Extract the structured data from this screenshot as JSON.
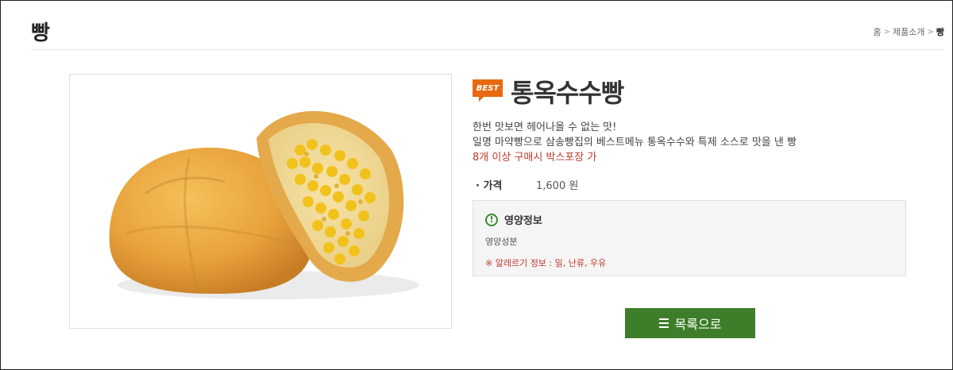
{
  "page": {
    "title": "빵"
  },
  "breadcrumb": {
    "home": "홈",
    "category": "제품소개",
    "current": "빵",
    "separator": ">"
  },
  "product": {
    "badge": "BEST",
    "name": "통옥수수빵",
    "desc_line1": "한번 맛보면 헤어나올 수 없는 맛!",
    "desc_line2": "일명 마약빵으로 삼송빵집의 베스트메뉴 통옥수수와 특제 소스로 맛을 낸 빵",
    "notice": "8개 이상 구매시 박스포장 가",
    "price_label": "· 가격",
    "price_value": "1,600 원"
  },
  "nutrition": {
    "icon_text": "!",
    "title": "영양정보",
    "subtitle": "영양성분",
    "allergy": "※ 알레르기 정보 : 밀, 난류, 우유"
  },
  "actions": {
    "list_button": "목록으로"
  },
  "colors": {
    "accent_green": "#3e7d2a",
    "badge_orange": "#e86a10",
    "notice_red": "#c0392b"
  }
}
